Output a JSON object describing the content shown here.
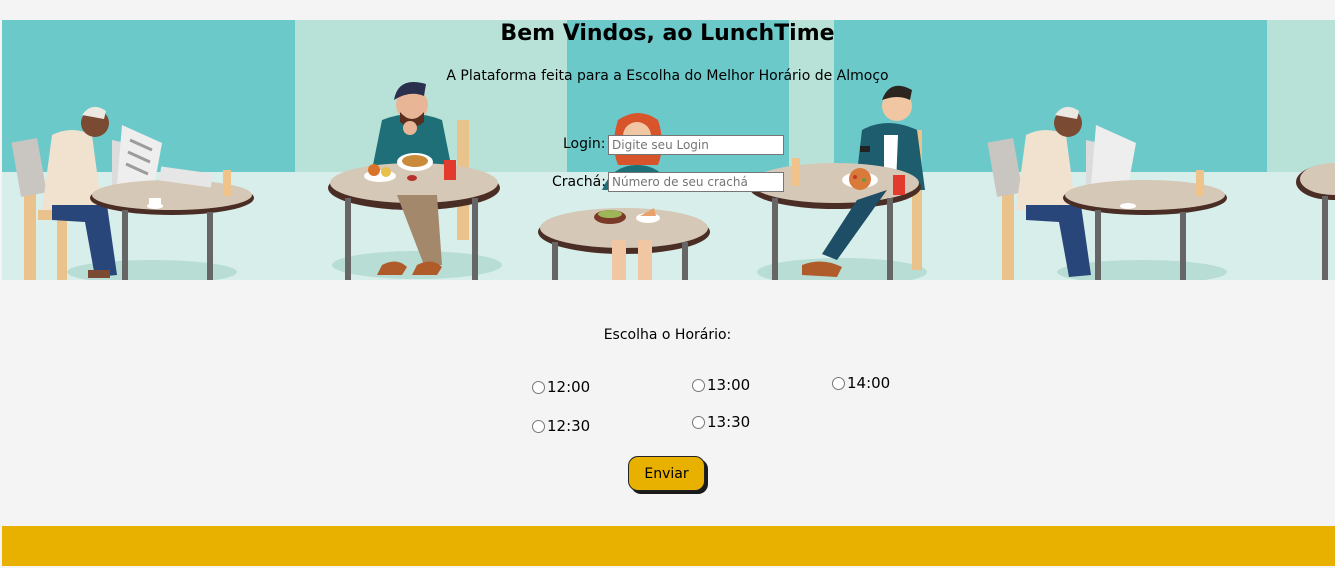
{
  "header": {
    "title": "Bem Vindos, ao LunchTime",
    "subtitle": "A Plataforma feita para a Escolha do Melhor Horário de Almoço"
  },
  "login": {
    "label": "Login:",
    "placeholder": "Digite seu Login",
    "value": ""
  },
  "badge": {
    "label": "Crachá:",
    "placeholder": "Número de seu crachá",
    "value": ""
  },
  "schedule": {
    "label": "Escolha o Horário:",
    "options": [
      "12:00",
      "13:00",
      "14:00",
      "12:30",
      "13:30"
    ],
    "selected": null
  },
  "submit": {
    "label": "Enviar"
  },
  "colors": {
    "background": "#f4f4f4",
    "accent": "#e8b100",
    "banner_teal": "#6cc9ca",
    "banner_mint": "#b8e2d8",
    "floor": "#d8eeea"
  }
}
